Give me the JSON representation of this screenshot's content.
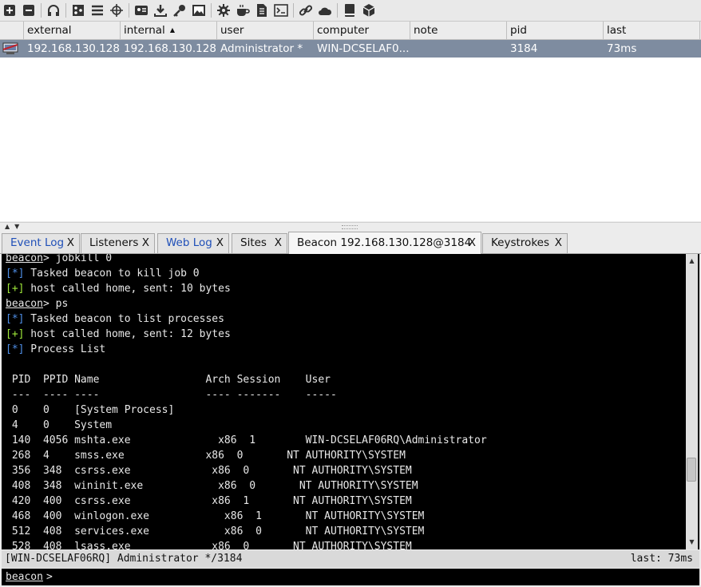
{
  "toolbar": {
    "icons": [
      "plus-icon",
      "minus-icon",
      "headphones-icon",
      "pivot-graph-icon",
      "list-icon",
      "target-icon",
      "credentials-icon",
      "download-icon",
      "key-icon",
      "image-icon",
      "gear-icon",
      "coffee-icon",
      "document-icon",
      "console-icon",
      "link-icon",
      "cloud-icon",
      "book-icon",
      "package-icon"
    ]
  },
  "table": {
    "columns": [
      "external",
      "internal",
      "user",
      "computer",
      "note",
      "pid",
      "last"
    ],
    "sort_column": "internal",
    "rows": [
      {
        "external": "192.168.130.128",
        "internal": "192.168.130.128",
        "user": "Administrator *",
        "computer": "WIN-DCSELAF0...",
        "note": "",
        "pid": "3184",
        "last": "73ms"
      }
    ]
  },
  "tabs": [
    {
      "label": "Event Log",
      "close": "X",
      "blue": true
    },
    {
      "label": "Listeners",
      "close": "X",
      "blue": false
    },
    {
      "label": "Web Log",
      "close": "X",
      "blue": true
    },
    {
      "label": "Sites",
      "close": "X",
      "blue": false
    },
    {
      "label": "Beacon 192.168.130.128@3184",
      "close": "X",
      "blue": false,
      "active": true
    },
    {
      "label": "Keystrokes",
      "close": "X",
      "blue": false
    }
  ],
  "console": {
    "prompt": "beacon",
    "lines": [
      {
        "t": "cmd",
        "text": "> jobkill 0"
      },
      {
        "t": "info",
        "text": " Tasked beacon to kill job 0"
      },
      {
        "t": "ok",
        "text": " host called home, sent: 10 bytes"
      },
      {
        "t": "cmd",
        "text": "> ps"
      },
      {
        "t": "info",
        "text": " Tasked beacon to list processes"
      },
      {
        "t": "ok",
        "text": " host called home, sent: 12 bytes"
      },
      {
        "t": "info",
        "text": " Process List"
      },
      {
        "t": "plain",
        "text": ""
      },
      {
        "t": "plain",
        "text": " PID  PPID Name                 Arch Session    User"
      },
      {
        "t": "plain",
        "text": " ---  ---- ----                 ---- -------    -----"
      },
      {
        "t": "plain",
        "text": " 0    0    [System Process]"
      },
      {
        "t": "plain",
        "text": " 4    0    System"
      },
      {
        "t": "plain",
        "text": " 140  4056 mshta.exe              x86  1        WIN-DCSELAF06RQ\\Administrator"
      },
      {
        "t": "plain",
        "text": " 268  4    smss.exe             x86  0       NT AUTHORITY\\SYSTEM"
      },
      {
        "t": "plain",
        "text": " 356  348  csrss.exe             x86  0       NT AUTHORITY\\SYSTEM"
      },
      {
        "t": "plain",
        "text": " 408  348  wininit.exe            x86  0       NT AUTHORITY\\SYSTEM"
      },
      {
        "t": "plain",
        "text": " 420  400  csrss.exe             x86  1       NT AUTHORITY\\SYSTEM"
      },
      {
        "t": "plain",
        "text": " 468  400  winlogon.exe            x86  1       NT AUTHORITY\\SYSTEM"
      },
      {
        "t": "plain",
        "text": " 512  408  services.exe            x86  0       NT AUTHORITY\\SYSTEM"
      },
      {
        "t": "plain",
        "text": " 528  408  lsass.exe             x86  0       NT AUTHORITY\\SYSTEM"
      }
    ],
    "info_tag": "[*]",
    "ok_tag": "[+]"
  },
  "status": {
    "left": "[WIN-DCSELAF06RQ] Administrator */3184",
    "right": "last: 73ms"
  },
  "input": {
    "prompt": "beacon",
    "suffix": ">",
    "value": ""
  },
  "colors": {
    "selected_row": "#7e8ca0",
    "info_tag": "#4f8fe8",
    "ok_tag": "#9fe83a",
    "console_bg": "#000000"
  }
}
